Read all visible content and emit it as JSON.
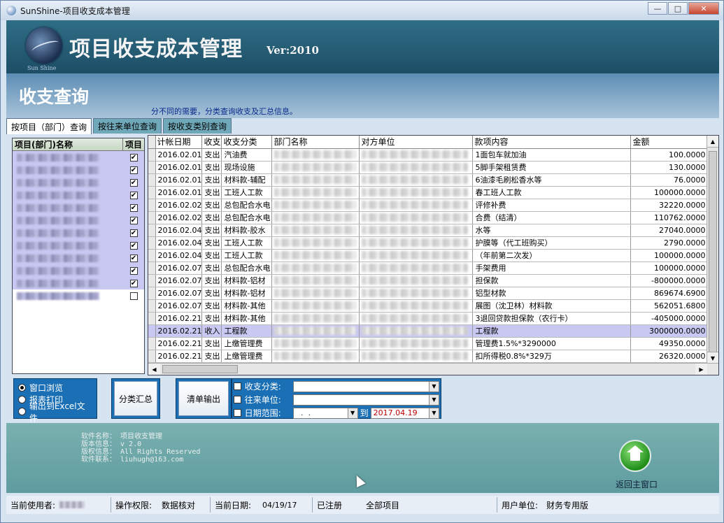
{
  "window": {
    "title": "SunShine-项目收支成本管理"
  },
  "banner": {
    "title": "项目收支成本管理",
    "version": "Ver:2010",
    "logo_caption": "Sun Shine"
  },
  "section": {
    "title": "收支查询",
    "description": "分不同的需要，分类查询收支及汇总信息。"
  },
  "tabs": [
    {
      "label": "按项目（部门）查询"
    },
    {
      "label": "按往来单位查询"
    },
    {
      "label": "按收支类别查询"
    }
  ],
  "left_panel": {
    "columns": [
      "项目(部门)名称",
      "项目"
    ],
    "rows_checked": [
      true,
      true,
      true,
      true,
      true,
      true,
      true,
      true,
      true,
      true,
      true,
      false
    ]
  },
  "grid": {
    "columns": [
      "计帐日期",
      "收支",
      "收支分类",
      "部门名称",
      "对方单位",
      "款项内容",
      "金额"
    ],
    "rows": [
      {
        "date": "2016.02.01",
        "type": "支出",
        "category": "汽油费",
        "content": "1面包车就加油",
        "amount": "100.0000"
      },
      {
        "date": "2016.02.01",
        "type": "支出",
        "category": "现场设施",
        "content": "5脚手架租赁费",
        "amount": "130.0000"
      },
      {
        "date": "2016.02.01",
        "type": "支出",
        "category": "材料款-辅配",
        "content": "6油漆毛刷松香水等",
        "amount": "76.0000"
      },
      {
        "date": "2016.02.01",
        "type": "支出",
        "category": "工班人工款",
        "content": "春工班人工款",
        "amount": "100000.0000"
      },
      {
        "date": "2016.02.02",
        "type": "支出",
        "category": "总包配合水电",
        "content": "评修补费",
        "amount": "32220.0000"
      },
      {
        "date": "2016.02.02",
        "type": "支出",
        "category": "总包配合水电",
        "content": "合费（结清）",
        "amount": "110762.0000"
      },
      {
        "date": "2016.02.04",
        "type": "支出",
        "category": "材料款-胶水",
        "content": "水等",
        "amount": "27040.0000"
      },
      {
        "date": "2016.02.04",
        "type": "支出",
        "category": "工班人工款",
        "content": "护膜等（代工班购买）",
        "amount": "2790.0000"
      },
      {
        "date": "2016.02.04",
        "type": "支出",
        "category": "工班人工款",
        "content": "（年前第二次发）",
        "amount": "100000.0000"
      },
      {
        "date": "2016.02.07",
        "type": "支出",
        "category": "总包配合水电",
        "content": "手架费用",
        "amount": "100000.0000"
      },
      {
        "date": "2016.02.07",
        "type": "支出",
        "category": "材料款-铝材",
        "content": "担保款",
        "amount": "-800000.0000"
      },
      {
        "date": "2016.02.07",
        "type": "支出",
        "category": "材料款-铝材",
        "content": "铝型材款",
        "amount": "869674.6900"
      },
      {
        "date": "2016.02.07",
        "type": "支出",
        "category": "材料款-其他",
        "content": "展图（沈卫林）材料款",
        "amount": "562051.6800"
      },
      {
        "date": "2016.02.21",
        "type": "支出",
        "category": "材料款-其他",
        "content": "3退回贷款担保款（农行卡）",
        "amount": "-405000.0000"
      },
      {
        "date": "2016.02.21",
        "type": "收入",
        "category": "工程款",
        "content": "工程款",
        "amount": "3000000.0000",
        "selected": true
      },
      {
        "date": "2016.02.21",
        "type": "支出",
        "category": "上缴管理费",
        "content": "管理费1.5%*3290000",
        "amount": "49350.0000"
      },
      {
        "date": "2016.02.21",
        "type": "支出",
        "category": "上缴管理费",
        "content": "扣所得税0.8%*329万",
        "amount": "26320.0000"
      }
    ]
  },
  "output_options": {
    "items": [
      {
        "label": "窗口浏览",
        "selected": true
      },
      {
        "label": "报表打印",
        "selected": false
      },
      {
        "label": "输出到Excel文件",
        "selected": false
      }
    ]
  },
  "buttons": {
    "summary": "分类汇总",
    "list_output": "清单输出"
  },
  "filters": {
    "category_label": "收支分类:",
    "partner_label": "往来单位:",
    "date_label": "日期范围:",
    "date_from": "  .  .",
    "to_label": "到",
    "date_to": "2017.04.19"
  },
  "footer": {
    "software_name": "软件名称： 项目收支管理",
    "version_info": "版本信息： v 2.0",
    "copyright": "版权信息： All Rights Reserved",
    "contact": "软件联系： liuhugh@163.com",
    "home_label": "返回主窗口"
  },
  "status": {
    "user_label": "当前使用者:",
    "permission_label": "操作权限:",
    "permission_value": "数据核对",
    "date_label": "当前日期:",
    "date_value": "04/19/17",
    "registered": "已注册",
    "all_projects": "全部项目",
    "unit_label": "用户单位:",
    "unit_value": "财务专用版"
  },
  "colors": {
    "accent_blue": "#1a6fb5",
    "selected_row": "#c8c8f2",
    "banner": "#2f6e86",
    "footer": "#6fa8aa"
  }
}
